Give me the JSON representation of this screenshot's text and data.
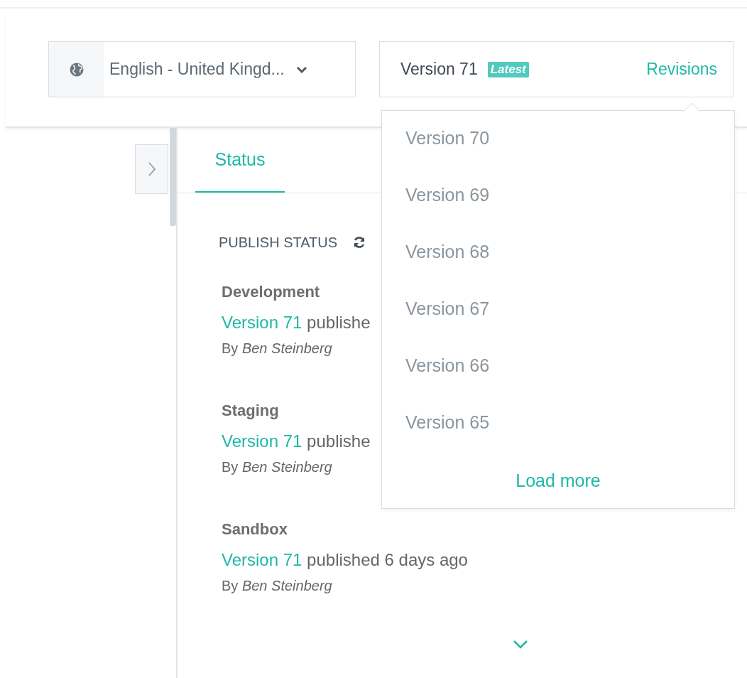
{
  "language_select": {
    "value": "English - United Kingd...",
    "expanded": false
  },
  "version_box": {
    "label": "Version 71",
    "badge": "Latest",
    "link": "Revisions"
  },
  "revisions_menu": {
    "open": true,
    "items": [
      "Version 70",
      "Version 69",
      "Version 68",
      "Version 67",
      "Version 66",
      "Version 65"
    ],
    "load_more": "Load more"
  },
  "sidebar_toggle": {
    "expanded": false
  },
  "tabs": [
    {
      "label": "Status",
      "selected": true
    }
  ],
  "publish_status": {
    "title": "PUBLISH STATUS",
    "environments": [
      {
        "name": "Development",
        "version_link": "Version 71",
        "text": "publishe",
        "by": "By",
        "author": "Ben Steinberg"
      },
      {
        "name": "Staging",
        "version_link": "Version 71",
        "text": "publishe",
        "by": "By",
        "author": "Ben Steinberg"
      },
      {
        "name": "Sandbox",
        "version_link": "Version 71",
        "text": "published 6 days ago",
        "by": "By",
        "author": "Ben Steinberg"
      }
    ]
  }
}
